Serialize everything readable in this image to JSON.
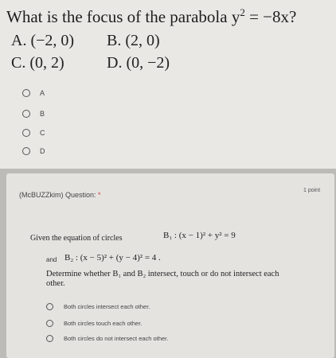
{
  "question1": {
    "title": "What is the focus of the parabola y",
    "title_exp": "2",
    "title_tail": " = −8x?",
    "choice_a": "A. (−2, 0)",
    "choice_b": "B. (2, 0)",
    "choice_c": "C. (0, 2)",
    "choice_d": "D. (0, −2)",
    "radio_options": [
      "A",
      "B",
      "C",
      "D"
    ]
  },
  "question2": {
    "header": "(McBUZZkim) Question:",
    "required_mark": "*",
    "points": "1 point",
    "intro": "Given the equation of circles",
    "eq1": "B₁ : (x − 1)² + y² = 9",
    "and_label": "and",
    "eq2": "B₂ : (x − 5)² + (y − 4)² = 4 .",
    "body": "Determine whether B₁ and B₂ intersect, touch or do not intersect each other.",
    "options": [
      "Both circles intersect each other.",
      "Both circles touch each other.",
      "Both circles do not intersect  each other."
    ]
  }
}
